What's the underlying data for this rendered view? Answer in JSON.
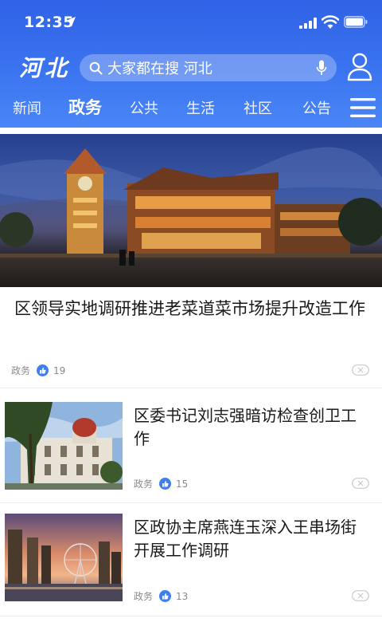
{
  "status_bar": {
    "time": "12:35"
  },
  "header": {
    "logo": "河北",
    "search_placeholder": "大家都在搜 河北"
  },
  "tabs": [
    {
      "label": "新闻",
      "active": false
    },
    {
      "label": "政务",
      "active": true
    },
    {
      "label": "公共",
      "active": false
    },
    {
      "label": "生活",
      "active": false
    },
    {
      "label": "社区",
      "active": false
    },
    {
      "label": "公告",
      "active": false
    }
  ],
  "feed": {
    "hero": {
      "title": "区领导实地调研推进老菜道菜市场提升改造工作",
      "category": "政务",
      "likes": "19"
    },
    "items": [
      {
        "title": "区委书记刘志强暗访检查创卫工作",
        "category": "政务",
        "likes": "15"
      },
      {
        "title": "区政协主席燕连玉深入王串场街开展工作调研",
        "category": "政务",
        "likes": "13"
      }
    ]
  },
  "colors": {
    "header_blue": "#3b74f0",
    "like_blue": "#3b7ff0",
    "text_gray": "#8a8a8a"
  }
}
